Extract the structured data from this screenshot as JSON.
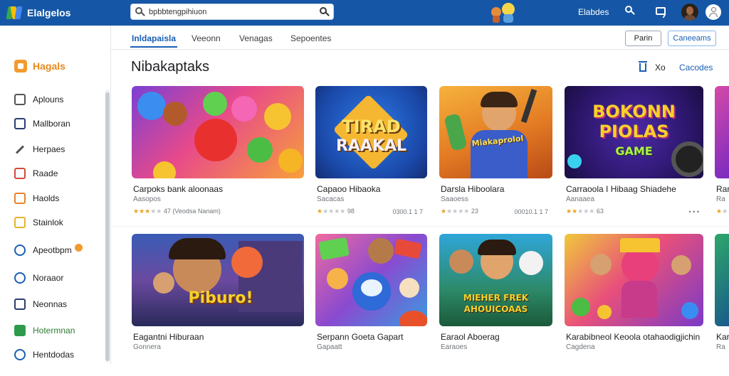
{
  "app": {
    "name": "Elalgelos"
  },
  "search": {
    "value": "bpbbtengpihiuon",
    "placeholder": ""
  },
  "header": {
    "link": "Elabdes"
  },
  "tabs": [
    {
      "label": "Inldapaisla",
      "active": true
    },
    {
      "label": "Veeonn"
    },
    {
      "label": "Venagas"
    },
    {
      "label": "Sepoentes"
    }
  ],
  "toolbar": {
    "button1": "Parin",
    "button2": "Caneeams"
  },
  "sidebar": {
    "heading": "Hagals",
    "items": [
      {
        "label": "Aplouns",
        "icon": "house-icon"
      },
      {
        "label": "Mallboran",
        "icon": "list-icon"
      },
      {
        "label": "Herpaes",
        "icon": "pencil-icon"
      },
      {
        "label": "Raade",
        "icon": "bookmark-icon"
      },
      {
        "label": "Haolds",
        "icon": "calendar-icon"
      },
      {
        "label": "Stainlok",
        "icon": "note-icon"
      },
      {
        "label": "Apeotbpm",
        "icon": "circle-icon",
        "badge": true
      },
      {
        "label": "Noraaor",
        "icon": "globe-icon"
      },
      {
        "label": "Neonnas",
        "icon": "window-icon"
      },
      {
        "label": "Hotermnan",
        "icon": "square-icon"
      },
      {
        "label": "Hentdodas",
        "icon": "folder-icon"
      }
    ]
  },
  "main": {
    "title": "Nibakaptaks",
    "actions": {
      "count": "Xo",
      "link": "Cacodes"
    }
  },
  "cards": [
    {
      "title": "Carpoks bank aloonaas",
      "sub": "Aasopos",
      "stars": 3,
      "rating": "47  (Veodsa Nanam)",
      "meta": ""
    },
    {
      "title": "Capaoo Hibaoka",
      "sub": "Sacacas",
      "stars": 1,
      "rating": "98",
      "meta": "0300.1 1 7"
    },
    {
      "title": "Darsla Hiboolara",
      "sub": "Saaoess",
      "stars": 1,
      "rating": "23",
      "meta": "00010.1 1 7"
    },
    {
      "title": "Carraoola I Hibaag Shiadehe",
      "sub": "Aanaaea",
      "stars": 2,
      "rating": "63",
      "meta": "• • •"
    },
    {
      "title": "Rar",
      "sub": "Ra",
      "stars": 1,
      "rating": "",
      "meta": ""
    },
    {
      "title": "Eagantni Hiburaan",
      "sub": "Gonnera",
      "stars": 0,
      "rating": "",
      "meta": ""
    },
    {
      "title": "Serpann Goeta Gapart",
      "sub": "Gapaatt",
      "stars": 0,
      "rating": "",
      "meta": ""
    },
    {
      "title": "Earaol Aboerag",
      "sub": "Earaoes",
      "stars": 0,
      "rating": "",
      "meta": ""
    },
    {
      "title": "Karabibneol Keoola otahaodigjichin",
      "sub": "Cagdena",
      "stars": 0,
      "rating": "",
      "meta": ""
    },
    {
      "title": "Kar",
      "sub": "Ra",
      "stars": 0,
      "rating": "",
      "meta": ""
    }
  ],
  "thumb_text": {
    "card2": [
      "TIRAD",
      "RAAKAL"
    ],
    "card3": "Miakaprolol",
    "card4": [
      "BOKONN",
      "PIOLAS",
      "GAME"
    ],
    "card6": "Piburo!",
    "card8": [
      "MIEHER FREK",
      "AHOUICOAAS"
    ]
  },
  "colors": {
    "header_bg": "#1557a6",
    "accent": "#1a5fb4",
    "star": "#e9a320"
  }
}
